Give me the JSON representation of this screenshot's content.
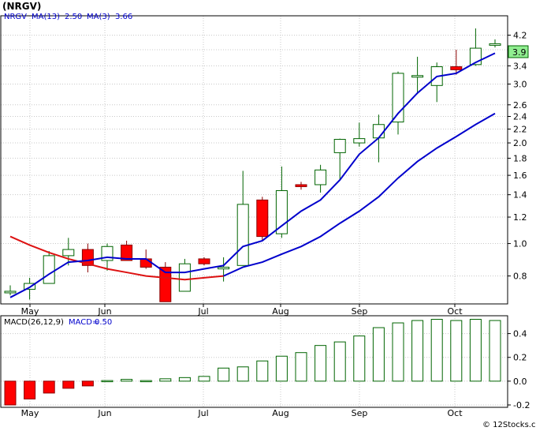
{
  "title": "(NRGV)",
  "watermark": "© 12Stocks.com",
  "colors": {
    "up_body": "#ffffff",
    "up_border": "#006400",
    "down_body": "#ff0000",
    "down_border": "#8b0000",
    "ma_fast": "#0000cc",
    "ma_slow": "#dd1111",
    "hist": "#006400",
    "hist_neg": "#ff0000",
    "grid": "#c8c8c8",
    "frame": "#000000",
    "last_price_box": "#90ee90"
  },
  "chart_data": [
    {
      "type": "candlestick",
      "name": "price",
      "scale": "log",
      "ylim": [
        0.66,
        4.8
      ],
      "legend": {
        "ticker": "NRGV",
        "ma13_label": "MA(13)",
        "ma13_value": "2.50",
        "ma3_label": "MA(3)",
        "ma3_value": "3.66"
      },
      "last_price": "3.9",
      "yticks": [
        "4.2",
        "3.8",
        "3.4",
        "3.0",
        "2.6",
        "2.4",
        "2.2",
        "2.0",
        "1.8",
        "1.6",
        "1.4",
        "1.2",
        "1.0",
        "0.8"
      ],
      "months": [
        "May",
        "Jun",
        "Jul",
        "Aug",
        "Sep",
        "Oct"
      ],
      "month_index": [
        1,
        5,
        10,
        14,
        18,
        23
      ],
      "candles": [
        {
          "o": 0.72,
          "h": 0.75,
          "l": 0.7,
          "c": 0.72
        },
        {
          "o": 0.73,
          "h": 0.79,
          "l": 0.68,
          "c": 0.76
        },
        {
          "o": 0.76,
          "h": 0.95,
          "l": 0.76,
          "c": 0.92
        },
        {
          "o": 0.92,
          "h": 1.04,
          "l": 0.86,
          "c": 0.96
        },
        {
          "o": 0.96,
          "h": 1.0,
          "l": 0.82,
          "c": 0.86
        },
        {
          "o": 0.89,
          "h": 1.0,
          "l": 0.83,
          "c": 0.98
        },
        {
          "o": 0.99,
          "h": 1.02,
          "l": 0.89,
          "c": 0.89
        },
        {
          "o": 0.9,
          "h": 0.96,
          "l": 0.84,
          "c": 0.85
        },
        {
          "o": 0.85,
          "h": 0.88,
          "l": 0.67,
          "c": 0.67
        },
        {
          "o": 0.72,
          "h": 0.9,
          "l": 0.72,
          "c": 0.87
        },
        {
          "o": 0.9,
          "h": 0.91,
          "l": 0.86,
          "c": 0.87
        },
        {
          "o": 0.84,
          "h": 0.91,
          "l": 0.77,
          "c": 0.85
        },
        {
          "o": 0.86,
          "h": 1.65,
          "l": 0.86,
          "c": 1.31
        },
        {
          "o": 1.35,
          "h": 1.38,
          "l": 1.02,
          "c": 1.05
        },
        {
          "o": 1.07,
          "h": 1.7,
          "l": 1.04,
          "c": 1.44
        },
        {
          "o": 1.5,
          "h": 1.53,
          "l": 1.45,
          "c": 1.48
        },
        {
          "o": 1.5,
          "h": 1.72,
          "l": 1.42,
          "c": 1.66
        },
        {
          "o": 1.87,
          "h": 2.06,
          "l": 1.55,
          "c": 2.05
        },
        {
          "o": 2.0,
          "h": 2.3,
          "l": 1.95,
          "c": 2.06
        },
        {
          "o": 2.07,
          "h": 2.43,
          "l": 1.75,
          "c": 2.27
        },
        {
          "o": 2.31,
          "h": 3.27,
          "l": 2.12,
          "c": 3.23
        },
        {
          "o": 3.18,
          "h": 3.62,
          "l": 2.8,
          "c": 3.18
        },
        {
          "o": 2.97,
          "h": 3.48,
          "l": 2.65,
          "c": 3.38
        },
        {
          "o": 3.38,
          "h": 3.8,
          "l": 3.2,
          "c": 3.31
        },
        {
          "o": 3.43,
          "h": 4.4,
          "l": 3.4,
          "c": 3.84
        },
        {
          "o": 3.93,
          "h": 4.08,
          "l": 3.86,
          "c": 3.96
        }
      ],
      "ma_fast": [
        0.69,
        0.74,
        0.81,
        0.88,
        0.89,
        0.91,
        0.9,
        0.9,
        0.82,
        0.82,
        0.84,
        0.86,
        0.98,
        1.02,
        1.13,
        1.25,
        1.35,
        1.55,
        1.85,
        2.07,
        2.45,
        2.82,
        3.16,
        3.23,
        3.48,
        3.71
      ],
      "ma_slow": [
        1.05,
        0.99,
        0.94,
        0.9,
        0.87,
        0.84,
        0.82,
        0.8,
        0.79,
        0.78,
        0.79,
        0.8,
        null,
        null,
        null,
        null,
        null,
        null,
        null,
        null,
        null,
        null,
        null,
        null,
        null,
        null
      ],
      "ma_slow_alt": [
        null,
        null,
        null,
        null,
        null,
        null,
        null,
        null,
        null,
        null,
        null,
        0.8,
        0.85,
        0.88,
        0.93,
        0.98,
        1.05,
        1.15,
        1.25,
        1.38,
        1.57,
        1.76,
        1.93,
        2.09,
        2.27,
        2.45
      ]
    },
    {
      "type": "bar",
      "name": "macd",
      "ylim": [
        -0.22,
        0.55
      ],
      "legend": {
        "label": "MACD(26,12,9)",
        "value_label": "MACD=",
        "value": "0.50"
      },
      "yticks": [
        "0.4",
        "0.2",
        "0.0",
        "-0.2"
      ],
      "ytick_values": [
        0.4,
        0.2,
        0.0,
        -0.2
      ],
      "months": [
        "May",
        "Jun",
        "Jul",
        "Aug",
        "Sep",
        "Oct"
      ],
      "values": [
        -0.2,
        -0.15,
        -0.1,
        -0.06,
        -0.04,
        0.005,
        0.015,
        0.005,
        0.02,
        0.03,
        0.04,
        0.11,
        0.12,
        0.17,
        0.21,
        0.24,
        0.3,
        0.33,
        0.38,
        0.45,
        0.49,
        0.51,
        0.52,
        0.51,
        0.52,
        0.51
      ]
    }
  ]
}
